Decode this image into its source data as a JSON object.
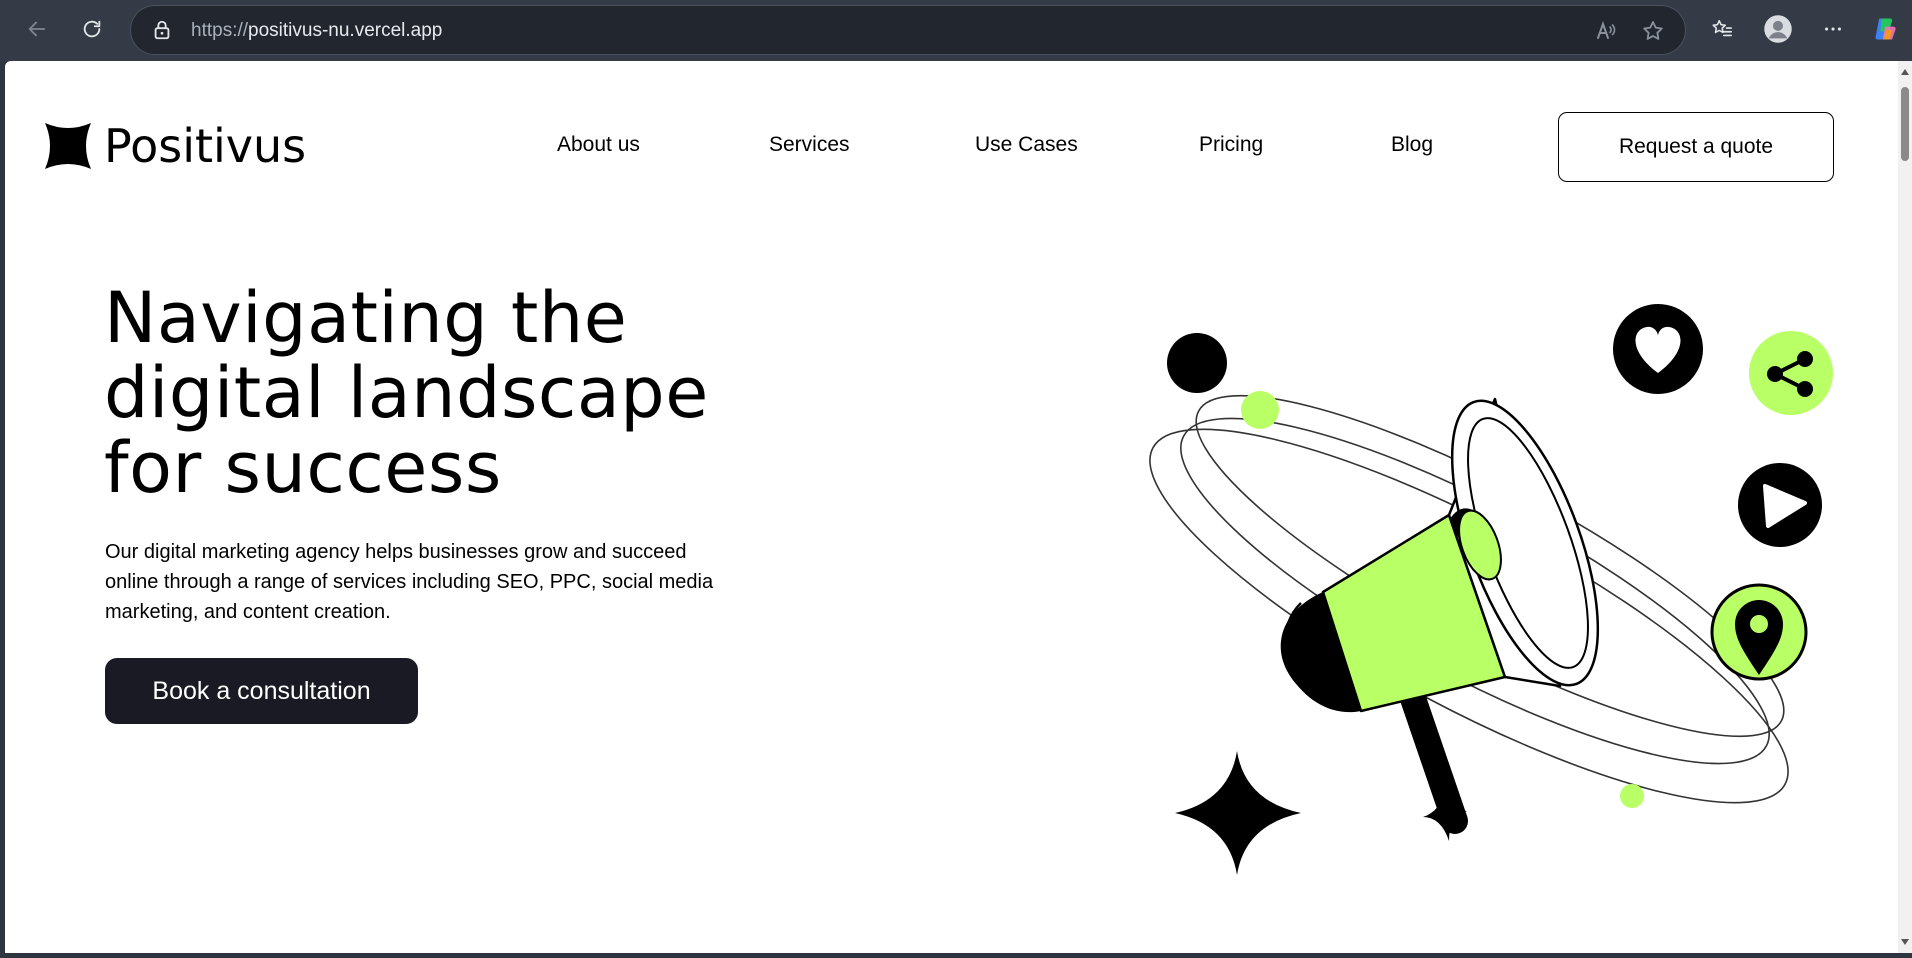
{
  "browser": {
    "url_protocol": "https://",
    "url_host": "positivus-nu.vercel.app"
  },
  "site": {
    "logo_text": "Positivus",
    "nav": [
      {
        "label": "About us"
      },
      {
        "label": "Services"
      },
      {
        "label": "Use Cases"
      },
      {
        "label": "Pricing"
      },
      {
        "label": "Blog"
      }
    ],
    "quote_button": "Request a quote"
  },
  "hero": {
    "title_lines": [
      "Navigating the",
      "digital landscape",
      "for success"
    ],
    "description": "Our digital marketing agency helps businesses grow and succeed online through a range of services including SEO, PPC, social media marketing, and content creation.",
    "cta": "Book a consultation"
  },
  "colors": {
    "accent": "#B9FF66",
    "dark": "#191A23",
    "chrome": "#343A46"
  }
}
